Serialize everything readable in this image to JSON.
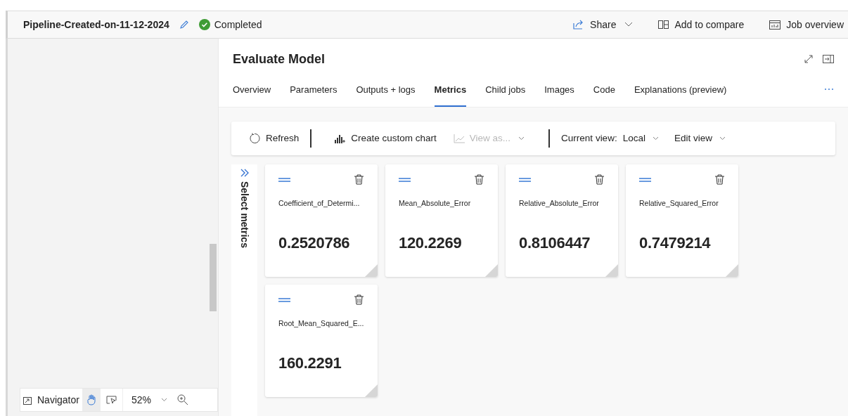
{
  "header": {
    "title": "Pipeline-Created-on-11-12-2024",
    "status": "Completed",
    "actions": [
      {
        "kind": "share",
        "label": "Share"
      },
      {
        "kind": "compare",
        "label": "Add to compare"
      },
      {
        "kind": "overview",
        "label": "Job overview"
      }
    ]
  },
  "navigator": {
    "label": "Navigator",
    "zoom": "52%",
    "pan_selected": true
  },
  "panel": {
    "title": "Evaluate Model",
    "tabs": [
      {
        "label": "Overview",
        "selected": false
      },
      {
        "label": "Parameters",
        "selected": false
      },
      {
        "label": "Outputs + logs",
        "selected": false
      },
      {
        "label": "Metrics",
        "selected": true
      },
      {
        "label": "Child jobs",
        "selected": false
      },
      {
        "label": "Images",
        "selected": false
      },
      {
        "label": "Code",
        "selected": false
      },
      {
        "label": "Explanations (preview)",
        "selected": false
      }
    ],
    "toolbar": {
      "refresh": "Refresh",
      "create_chart": "Create custom chart",
      "view_as": {
        "label": "View as...",
        "disabled": true
      },
      "current_view_label": "Current view:",
      "current_view": "Local",
      "edit_view": "Edit view"
    },
    "side_label": "Select metrics",
    "metrics": [
      {
        "name": "Coefficient_of_Determi...",
        "value": "0.2520786"
      },
      {
        "name": "Mean_Absolute_Error",
        "value": "120.2269"
      },
      {
        "name": "Relative_Absolute_Error",
        "value": "0.8106447"
      },
      {
        "name": "Relative_Squared_Error",
        "value": "0.7479214"
      },
      {
        "name": "Root_Mean_Squared_E...",
        "value": "160.2291"
      }
    ]
  }
}
